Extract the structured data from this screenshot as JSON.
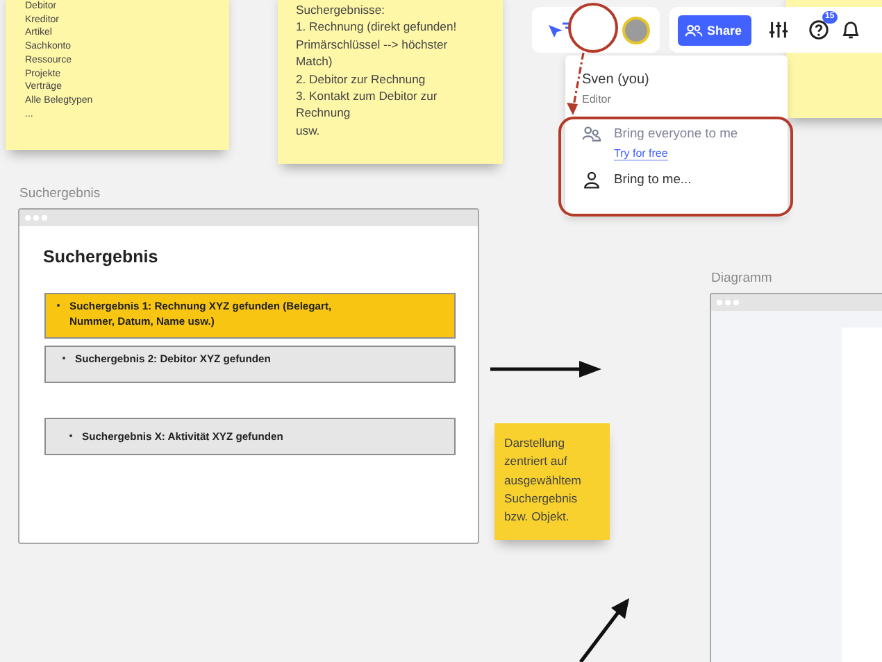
{
  "sticky_note_list": {
    "color": "#fff7a8",
    "lines": [
      "Debitor",
      "Kreditor",
      "Artikel",
      "Sachkonto",
      "Ressource",
      "Projekte",
      "Verträge",
      "Alle Belegtypen",
      "..."
    ]
  },
  "sticky_note_results": {
    "color": "#fff7a8",
    "lines": [
      "Suchergebnisse:",
      "1. Rechnung (direkt gefunden!",
      "Primärschlüssel --> höchster",
      "Match)",
      "2. Debitor zur Rechnung",
      "3. Kontakt zum Debitor zur",
      "Rechnung",
      "usw."
    ]
  },
  "sticky_note_corner": {
    "color": "#fff7a8"
  },
  "toolbar": {
    "share_label": "Share",
    "help_badge": "15"
  },
  "user_menu": {
    "name": "Sven (you)",
    "role": "Editor",
    "actions": [
      {
        "label": "Bring everyone to me",
        "kind": "group",
        "disabled": true,
        "link": "Try for free"
      },
      {
        "label": "Bring to me...",
        "kind": "single",
        "disabled": false
      }
    ]
  },
  "search_result": {
    "frame_label": "Suchergebnis",
    "heading": "Suchergebnis",
    "results": [
      {
        "text": "Suchergebnis 1: Rechnung XYZ gefunden (Belegart, Nummer, Datum, Name usw.)",
        "selected": true
      },
      {
        "text": "Suchergebnis 2: Debitor XYZ gefunden",
        "selected": false
      },
      {
        "text": "Suchergebnis X: Aktivität XYZ gefunden",
        "selected": false
      }
    ]
  },
  "sticky_note_hint": {
    "color": "#f8d12e",
    "lines": [
      "Darstellung",
      "zentriert auf",
      "ausgewähltem",
      "Suchergebnis",
      "bzw. Objekt."
    ]
  },
  "diagram": {
    "frame_label": "Diagramm"
  }
}
